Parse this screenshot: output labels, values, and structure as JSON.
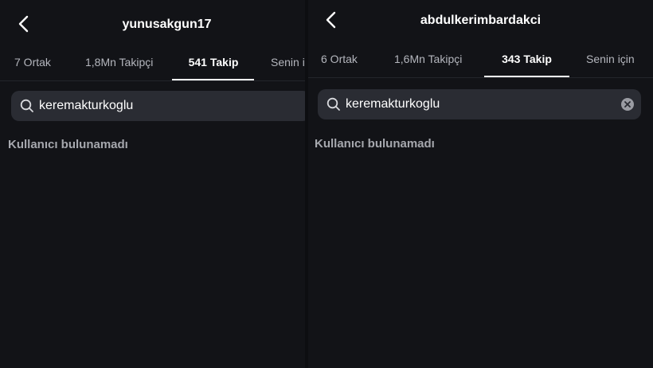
{
  "left": {
    "title": "yunusakgun17",
    "tabs": [
      {
        "label": "7 Ortak"
      },
      {
        "label": "1,8Mn Takipçi"
      },
      {
        "label": "541 Takip"
      },
      {
        "label": "Senin i"
      }
    ],
    "active_tab": 2,
    "search": {
      "value": "keremakturkoglu"
    },
    "empty_message": "Kullanıcı bulunamadı"
  },
  "right": {
    "title": "abdulkerimbardakci",
    "tabs": [
      {
        "label": "6 Ortak"
      },
      {
        "label": "1,6Mn Takipçi"
      },
      {
        "label": "343 Takip"
      },
      {
        "label": "Senin için"
      }
    ],
    "active_tab": 2,
    "search": {
      "value": "keremakturkoglu"
    },
    "empty_message": "Kullanıcı bulunamadı"
  },
  "icons": {
    "back": "chevron-left-icon",
    "search": "search-icon",
    "clear": "clear-icon"
  },
  "colors": {
    "background": "#121317",
    "search_field": "#2a2c33",
    "text_primary": "#ffffff",
    "text_muted": "#a6a8ae"
  }
}
